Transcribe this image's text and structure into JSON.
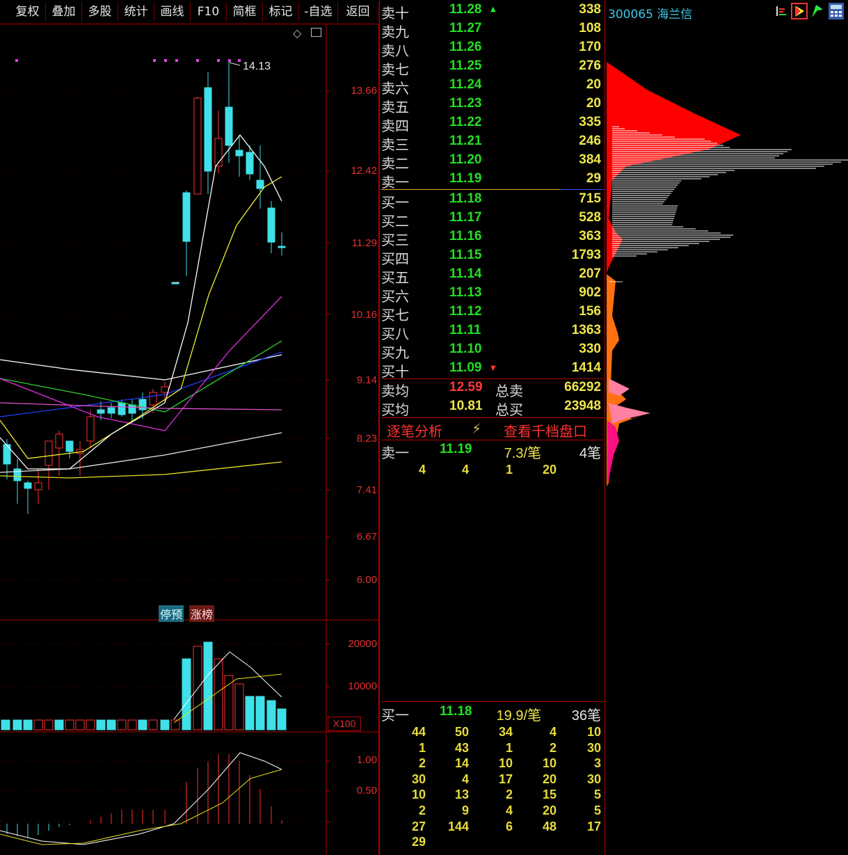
{
  "toolbar": {
    "buttons": [
      "复权",
      "叠加",
      "多股",
      "统计",
      "画线",
      "F10",
      "简框",
      "标记",
      "-自选",
      "返回"
    ]
  },
  "stock": {
    "code_name": "300065 海兰信"
  },
  "kline": {
    "price_axis": [
      "13.66",
      "12.42",
      "11.29",
      "10.16",
      "9.14",
      "8.23",
      "7.41",
      "6.67",
      "6.00"
    ],
    "high_label": "14.13",
    "tags": [
      "停预",
      "涨榜"
    ]
  },
  "volume": {
    "axis": [
      "20000",
      "10000"
    ],
    "unit": "X100"
  },
  "macd": {
    "axis": [
      "1.00",
      "0.50"
    ]
  },
  "orderbook": {
    "sells": [
      {
        "label": "卖十",
        "price": "11.28",
        "vol": "338"
      },
      {
        "label": "卖九",
        "price": "11.27",
        "vol": "108"
      },
      {
        "label": "卖八",
        "price": "11.26",
        "vol": "170"
      },
      {
        "label": "卖七",
        "price": "11.25",
        "vol": "276"
      },
      {
        "label": "卖六",
        "price": "11.24",
        "vol": "20"
      },
      {
        "label": "卖五",
        "price": "11.23",
        "vol": "20"
      },
      {
        "label": "卖四",
        "price": "11.22",
        "vol": "335"
      },
      {
        "label": "卖三",
        "price": "11.21",
        "vol": "246"
      },
      {
        "label": "卖二",
        "price": "11.20",
        "vol": "384"
      },
      {
        "label": "卖一",
        "price": "11.19",
        "vol": "29"
      }
    ],
    "buys": [
      {
        "label": "买一",
        "price": "11.18",
        "vol": "715"
      },
      {
        "label": "买二",
        "price": "11.17",
        "vol": "528"
      },
      {
        "label": "买三",
        "price": "11.16",
        "vol": "363"
      },
      {
        "label": "买四",
        "price": "11.15",
        "vol": "1793"
      },
      {
        "label": "买五",
        "price": "11.14",
        "vol": "207"
      },
      {
        "label": "买六",
        "price": "11.13",
        "vol": "902"
      },
      {
        "label": "买七",
        "price": "11.12",
        "vol": "156"
      },
      {
        "label": "买八",
        "price": "11.11",
        "vol": "1363"
      },
      {
        "label": "买九",
        "price": "11.10",
        "vol": "330"
      },
      {
        "label": "买十",
        "price": "11.09",
        "vol": "1414"
      }
    ],
    "avg_sell": {
      "label": "卖均",
      "price": "12.59",
      "total_label": "总卖",
      "total": "66292"
    },
    "avg_buy": {
      "label": "买均",
      "price": "10.81",
      "total_label": "总买",
      "total": "23948"
    }
  },
  "links": {
    "trade_analysis": "逐笔分析",
    "view_depth": "查看千档盘口"
  },
  "queue_sell": {
    "label": "卖一",
    "price": "11.19",
    "per": "7.3/笔",
    "count": "4笔",
    "rows": [
      [
        "4",
        "4",
        "1",
        "20"
      ]
    ]
  },
  "queue_buy": {
    "label": "买一",
    "price": "11.18",
    "per": "19.9/笔",
    "count": "36笔",
    "rows": [
      [
        "44",
        "50",
        "34",
        "4",
        "10"
      ],
      [
        "1",
        "43",
        "1",
        "2",
        "30"
      ],
      [
        "2",
        "14",
        "10",
        "10",
        "3"
      ],
      [
        "30",
        "4",
        "17",
        "20",
        "30"
      ],
      [
        "10",
        "13",
        "2",
        "15",
        "5"
      ],
      [
        "2",
        "9",
        "4",
        "20",
        "5"
      ],
      [
        "27",
        "144",
        "6",
        "48",
        "17"
      ],
      [
        "29",
        "",
        "",
        "",
        ""
      ]
    ]
  },
  "colors": {
    "up": "#ff3030",
    "down": "#3fe0e8",
    "grid": "#b00000",
    "price_green": "#22e022",
    "vol_yellow": "#f0e64a"
  }
}
